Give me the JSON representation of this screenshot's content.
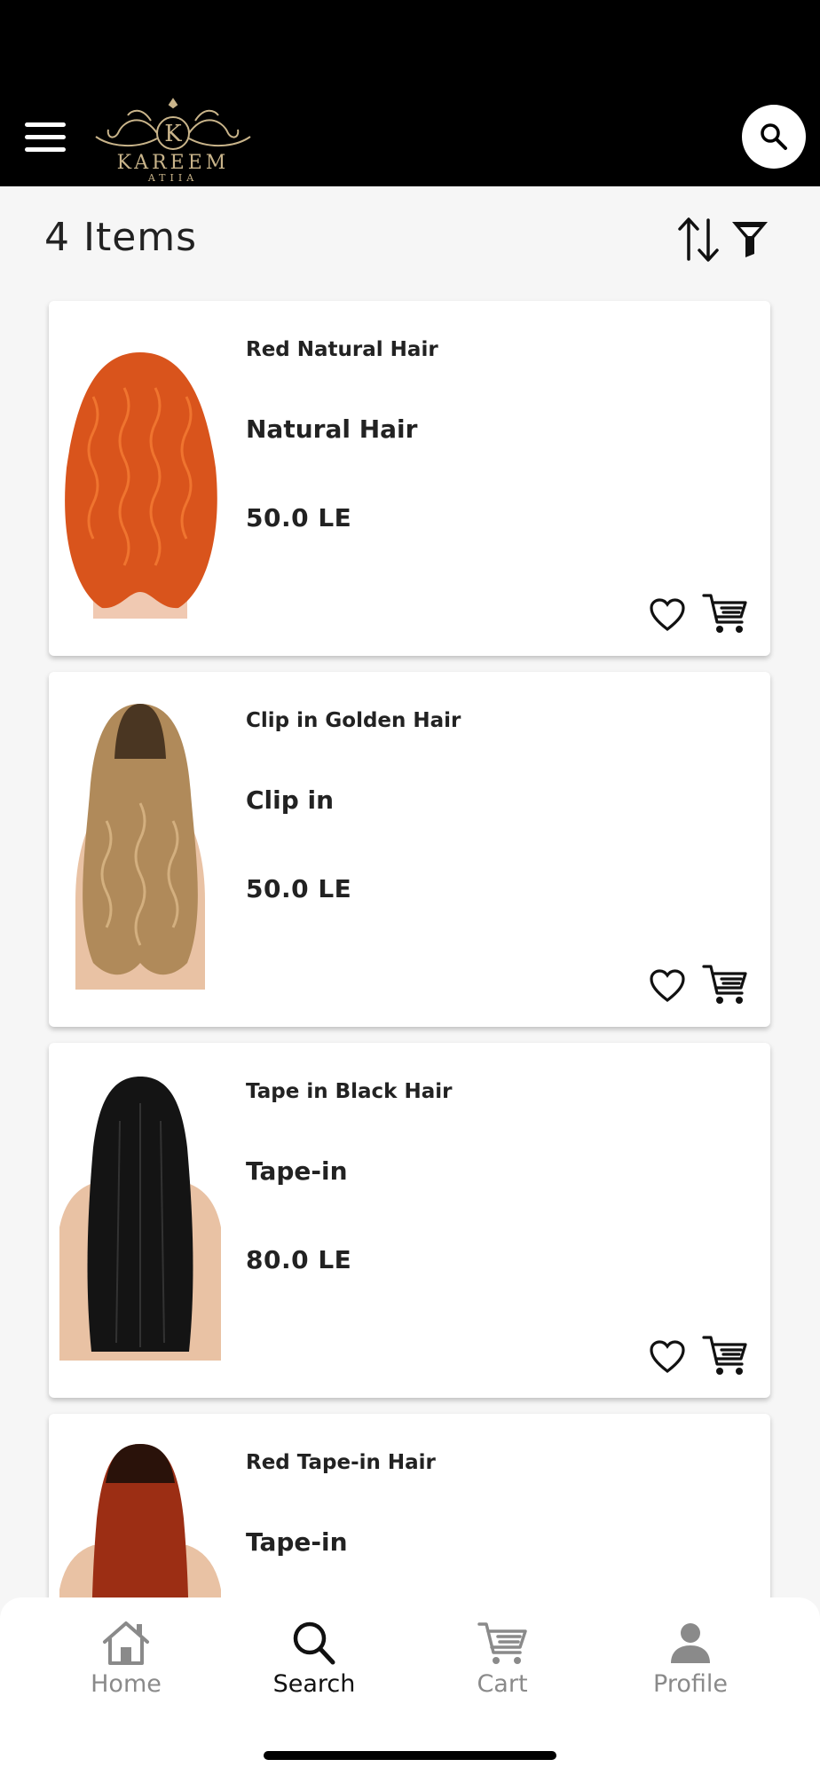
{
  "header": {
    "logo_icon": "kareem-atiia-logo",
    "logo_text": "KAREEM",
    "logo_subtext": "ATIIA",
    "logo_color": "#c9b48a",
    "menu_icon": "hamburger-menu-icon",
    "search_icon": "search-icon"
  },
  "toolbar": {
    "items_count": "4  Items",
    "sort_icon": "sort-arrows-icon",
    "filter_icon": "filter-funnel-icon"
  },
  "products": [
    {
      "name": "Red Natural  Hair",
      "category": "Natural Hair",
      "price": "50.0 LE",
      "hair_color": "#d9541c"
    },
    {
      "name": "Clip in Golden Hair",
      "category": "Clip in",
      "price": "50.0 LE",
      "hair_color": "#b08a5a"
    },
    {
      "name": "Tape in Black Hair",
      "category": "Tape-in",
      "price": "80.0 LE",
      "hair_color": "#141414"
    },
    {
      "name": "Red Tape-in Hair",
      "category": "Tape-in",
      "price": "",
      "hair_color": "#9c2e14"
    }
  ],
  "bottom_nav": [
    {
      "label": "Home",
      "icon": "home-icon",
      "active": false
    },
    {
      "label": "Search",
      "icon": "search-icon",
      "active": true
    },
    {
      "label": "Cart",
      "icon": "cart-icon",
      "active": false
    },
    {
      "label": "Profile",
      "icon": "profile-icon",
      "active": false
    }
  ],
  "colors": {
    "header_bg": "#000000",
    "page_bg": "#f6f6f6",
    "nav_active": "#111111",
    "nav_inactive": "#8a8a8a"
  }
}
